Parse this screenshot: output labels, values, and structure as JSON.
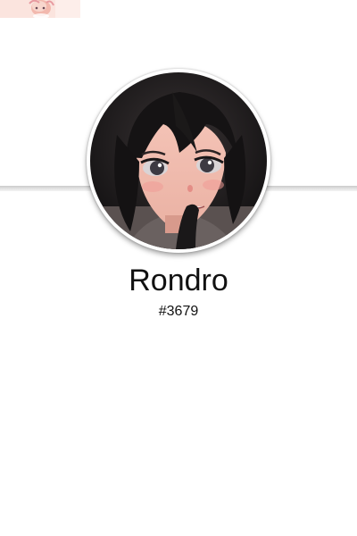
{
  "profile": {
    "username": "Rondro",
    "discriminator": "#3679",
    "avatar_icon": "avatar-anime-girl-image",
    "banner_icon": "banner-thumbnail-image"
  },
  "colors": {
    "background": "#ffffff",
    "text": "#111111",
    "divider": "#d0d0d0"
  }
}
